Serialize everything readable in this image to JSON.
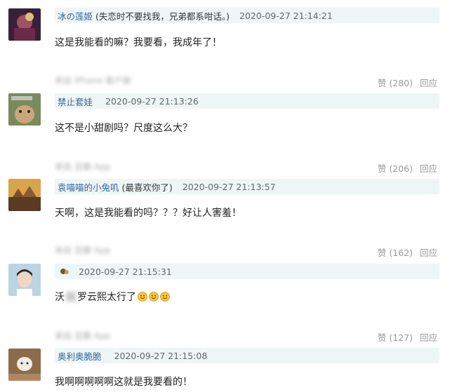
{
  "comments": [
    {
      "username": "冰の莲姬",
      "note": "(失恋时不要找我，兄弟都系咁话。)",
      "time": "2020-09-27 21:14:21",
      "text": "这是我能看的嘛？我要看，我成年了！",
      "source": "来自 iPhone 客户端",
      "like": "赞 (280)",
      "reply": "回应"
    },
    {
      "username": "禁止套娃",
      "note": "",
      "time": "2020-09-27 21:13:26",
      "text": "这不是小甜剧吗？尺度这么大？",
      "source": "来自 豆瓣 App",
      "like": "赞 (206)",
      "reply": "回应"
    },
    {
      "username": "袁喵喵的小兔叽",
      "note": "(最喜欢你了)",
      "time": "2020-09-27 21:13:57",
      "text": "天啊，这是我能看的吗？？？好让人害羞！",
      "source": "来自 豆瓣 App",
      "like": "赞 (162)",
      "reply": "回应"
    },
    {
      "username": "",
      "note": "",
      "time": "2020-09-27 21:15:31",
      "text_before": "沃",
      "text_after": "罗云熙太行了",
      "source": "来自 豆瓣 App",
      "like": "赞 (127)",
      "reply": "回应"
    },
    {
      "username": "奥利奥脆脆",
      "note": "",
      "time": "2020-09-27 21:15:08",
      "text": "我啊啊啊啊啊这就是我要看的！"
    }
  ],
  "colors": {
    "username": "#336699",
    "header_bg": "#eef5f6",
    "muted": "#999999"
  },
  "icons": [
    "smiley-emoji-icon"
  ]
}
